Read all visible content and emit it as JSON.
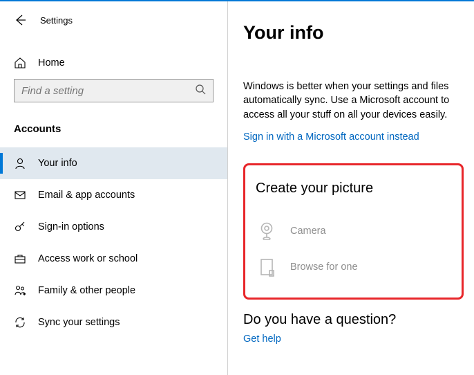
{
  "header": {
    "title": "Settings"
  },
  "search": {
    "placeholder": "Find a setting"
  },
  "sidebar": {
    "home": "Home",
    "section": "Accounts",
    "items": [
      {
        "label": "Your info"
      },
      {
        "label": "Email & app accounts"
      },
      {
        "label": "Sign-in options"
      },
      {
        "label": "Access work or school"
      },
      {
        "label": "Family & other people"
      },
      {
        "label": "Sync your settings"
      }
    ]
  },
  "main": {
    "title": "Your info",
    "description": "Windows is better when your settings and files automatically sync. Use a Microsoft account to access all your stuff on all your devices easily.",
    "signin_link": "Sign in with a Microsoft account instead",
    "create_picture": {
      "title": "Create your picture",
      "camera": "Camera",
      "browse": "Browse for one"
    },
    "question": {
      "title": "Do you have a question?",
      "link": "Get help"
    }
  }
}
